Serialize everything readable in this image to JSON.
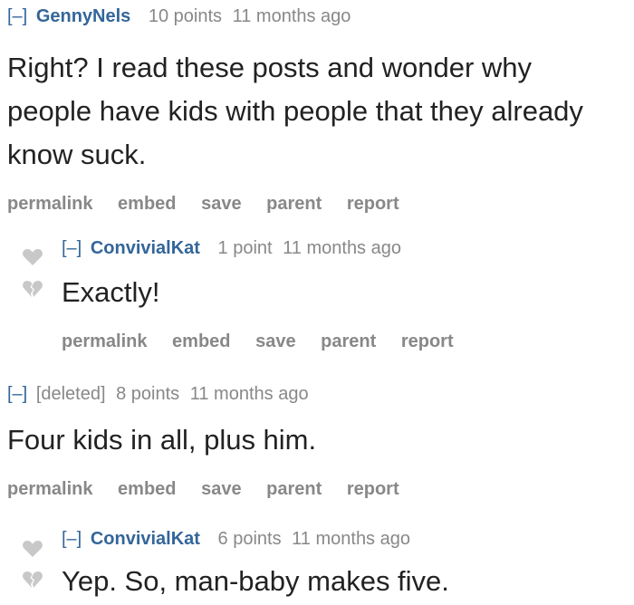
{
  "comments": [
    {
      "toggle": "[–]",
      "author": "GennyNels",
      "score": "10 points",
      "time": "11 months ago",
      "body_lines": [
        "Right? I read these posts and wonder why",
        "people have kids with people that they already",
        "know suck."
      ],
      "buttons": [
        "permalink",
        "embed",
        "save",
        "parent",
        "report"
      ]
    },
    {
      "toggle": "[–]",
      "author": "ConvivialKat",
      "score": "1 point",
      "time": "11 months ago",
      "body": "Exactly!",
      "buttons": [
        "permalink",
        "embed",
        "save",
        "parent",
        "report"
      ]
    },
    {
      "toggle": "[–]",
      "author": "[deleted]",
      "score": "8 points",
      "time": "11 months ago",
      "body": "Four kids in all, plus him.",
      "buttons": [
        "permalink",
        "embed",
        "save",
        "parent",
        "report"
      ]
    },
    {
      "toggle": "[–]",
      "author": "ConvivialKat",
      "score": "6 points",
      "time": "11 months ago",
      "body": "Yep. So, man-baby makes five."
    }
  ],
  "icons": {
    "upvote": "heart-upvote-icon",
    "downvote": "broken-heart-downvote-icon"
  },
  "colors": {
    "author": "#336699",
    "meta": "#888888",
    "body": "#222222",
    "vote": "#c8c8c8"
  }
}
